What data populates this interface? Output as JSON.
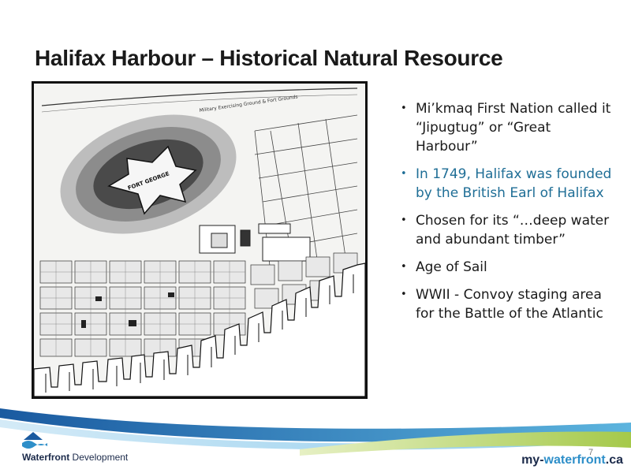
{
  "slide": {
    "title": "Halifax Harbour – Historical Natural Resource",
    "page_number": "7"
  },
  "map": {
    "labels": {
      "fort": "FORT GEORGE",
      "top_road": "Military Exercising Ground & Fort Grounds"
    }
  },
  "bullets": [
    {
      "text": "Mi’kmaq First Nation called it “Jipugtug” or “Great Harbour”",
      "highlight": false
    },
    {
      "text": "In 1749, Halifax was founded by the British Earl of Halifax",
      "highlight": true
    },
    {
      "text": "Chosen for its “…deep water and abundant timber”",
      "highlight": false
    },
    {
      "text": "Age of Sail",
      "highlight": false
    },
    {
      "text": "WWII - Convoy staging area for the Battle of the Atlantic",
      "highlight": false
    }
  ],
  "footer": {
    "logo_bold": "Waterfront",
    "logo_rest": " Development",
    "website_part1": "my-",
    "website_part2": "waterfront",
    "website_part3": ".ca"
  },
  "colors": {
    "highlight": "#1f6e96",
    "wave_dark_blue": "#1a5aa0",
    "wave_light_blue": "#5cb4de",
    "wave_green": "#a5c94a"
  }
}
